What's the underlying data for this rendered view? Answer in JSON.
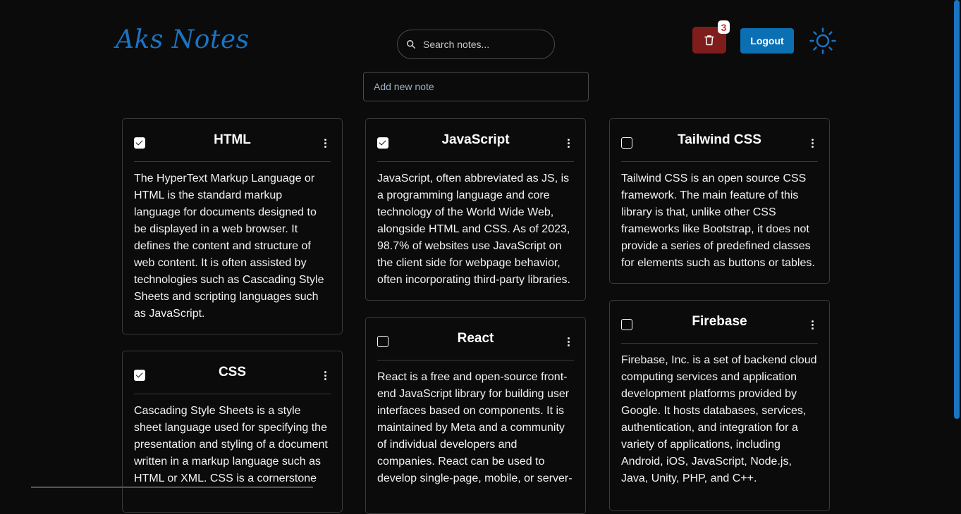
{
  "header": {
    "logo": "Aks Notes",
    "search_placeholder": "Search notes...",
    "trash_count": "3",
    "logout_label": "Logout"
  },
  "add_note_placeholder": "Add new note",
  "colors": {
    "background": "#0b0b0b",
    "accent": "#1a74c4",
    "trash": "#7f1d1d",
    "logout": "#0b6fb3"
  },
  "notes": [
    {
      "title": "HTML",
      "checked": true,
      "body": "The HyperText Markup Language or HTML is the standard markup language for documents designed to be displayed in a web browser. It defines the content and structure of web content. It is often assisted by technologies such as Cascading Style Sheets and scripting languages such as JavaScript."
    },
    {
      "title": "CSS",
      "checked": true,
      "body": "Cascading Style Sheets is a style sheet language used for specifying the presentation and styling of a document written in a markup language such as HTML or XML. CSS is a cornerstone"
    },
    {
      "title": "JavaScript",
      "checked": true,
      "body": "JavaScript, often abbreviated as JS, is a programming language and core technology of the World Wide Web, alongside HTML and CSS. As of 2023, 98.7% of websites use JavaScript on the client side for webpage behavior, often incorporating third-party libraries."
    },
    {
      "title": "React",
      "checked": false,
      "body": "React is a free and open-source front-end JavaScript library for building user interfaces based on components. It is maintained by Meta and a community of individual developers and companies. React can be used to develop single-page, mobile, or server-"
    },
    {
      "title": "Tailwind CSS",
      "checked": false,
      "body": "Tailwind CSS is an open source CSS framework. The main feature of this library is that, unlike other CSS frameworks like Bootstrap, it does not provide a series of predefined classes for elements such as buttons or tables."
    },
    {
      "title": "Firebase",
      "checked": false,
      "body": "Firebase, Inc. is a set of backend cloud computing services and application development platforms provided by Google. It hosts databases, services, authentication, and integration for a variety of applications, including Android, iOS, JavaScript, Node.js, Java, Unity, PHP, and C++."
    }
  ]
}
